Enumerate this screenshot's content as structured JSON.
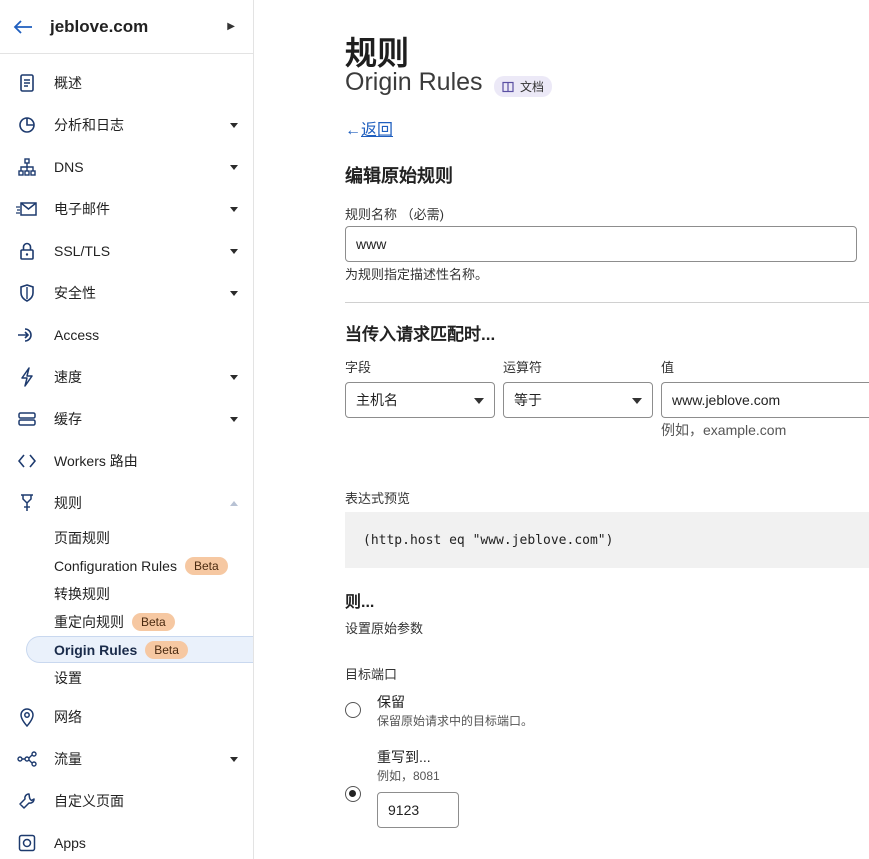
{
  "sidebar": {
    "domain": "jeblove.com",
    "items": [
      {
        "label": "概述",
        "icon": "document-icon",
        "caret": "none"
      },
      {
        "label": "分析和日志",
        "icon": "pie-chart-icon",
        "caret": "down"
      },
      {
        "label": "DNS",
        "icon": "network-tree-icon",
        "caret": "down"
      },
      {
        "label": "电子邮件",
        "icon": "email-icon",
        "caret": "down"
      },
      {
        "label": "SSL/TLS",
        "icon": "lock-icon",
        "caret": "down"
      },
      {
        "label": "安全性",
        "icon": "shield-icon",
        "caret": "down"
      },
      {
        "label": "Access",
        "icon": "access-arrow-icon",
        "caret": "none"
      },
      {
        "label": "速度",
        "icon": "lightning-icon",
        "caret": "down"
      },
      {
        "label": "缓存",
        "icon": "storage-icon",
        "caret": "down"
      },
      {
        "label": "Workers 路由",
        "icon": "code-brackets-icon",
        "caret": "none"
      },
      {
        "label": "规则",
        "icon": "funnel-fork-icon",
        "caret": "up"
      },
      {
        "label": "网络",
        "icon": "location-pin-icon",
        "caret": "none"
      },
      {
        "label": "流量",
        "icon": "traffic-share-icon",
        "caret": "down"
      },
      {
        "label": "自定义页面",
        "icon": "wrench-icon",
        "caret": "none"
      },
      {
        "label": "Apps",
        "icon": "apps-square-icon",
        "caret": "none"
      }
    ],
    "sub_items": [
      {
        "label": "页面规则",
        "badge": ""
      },
      {
        "label": "Configuration Rules",
        "badge": "Beta"
      },
      {
        "label": "转换规则",
        "badge": ""
      },
      {
        "label": "重定向规则",
        "badge": "Beta"
      },
      {
        "label": "Origin Rules",
        "badge": "Beta",
        "active": true
      },
      {
        "label": "设置",
        "badge": ""
      }
    ]
  },
  "main": {
    "title": "规则",
    "subtitle": "Origin Rules",
    "docs_label": "文档",
    "back_label": "返回",
    "edit_heading": "编辑原始规则",
    "rule_name_label": "规则名称 （必需)",
    "rule_name_value": "www",
    "rule_name_help": "为规则指定描述性名称。",
    "match_heading": "当传入请求匹配时...",
    "field_label": "字段",
    "operator_label": "运算符",
    "value_label": "值",
    "field_value": "主机名",
    "operator_value": "等于",
    "value_value": "www.jeblove.com",
    "value_example": "例如，example.com",
    "expression_label": "表达式预览",
    "expression": "(http.host eq \"www.jeblove.com\")",
    "then_heading": "则...",
    "then_help": "设置原始参数",
    "dest_port_label": "目标端口",
    "preserve_label": "保留",
    "preserve_desc": "保留原始请求中的目标端口。",
    "rewrite_label": "重写到...",
    "rewrite_desc": "例如，8081",
    "rewrite_value": "9123",
    "selected_option": "rewrite"
  },
  "colors": {
    "accent": "#1f5fbf",
    "beta_badge": "#f6c8a2",
    "active_bg": "#eaf1fb",
    "docs_pill": "#ece9f7"
  }
}
